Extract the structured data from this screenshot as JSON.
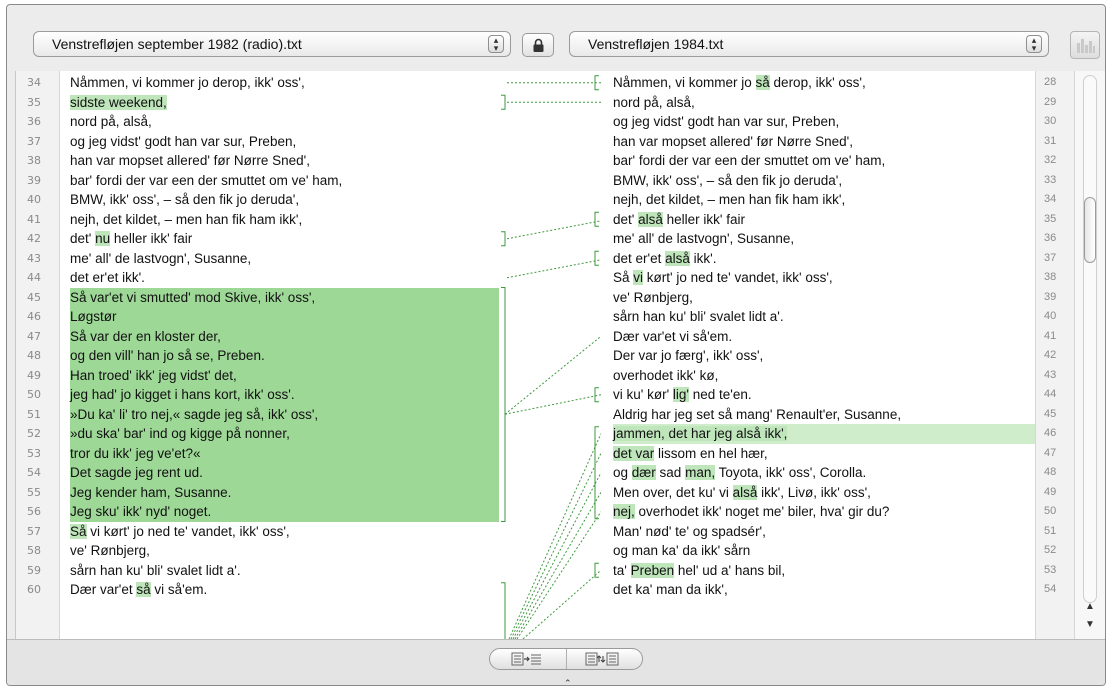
{
  "toolbar": {
    "left_file": "Venstrefløjen september 1982 (radio).txt",
    "right_file": "Venstrefløjen 1984.txt",
    "stepper_glyph": "▴▾"
  },
  "icons": [
    "lock-icon",
    "compare-view-icon",
    "merge-left-icon",
    "sync-icon",
    "scroll-up-icon",
    "scroll-down-icon"
  ],
  "left_lines": [
    {
      "n": "34",
      "segs": [
        {
          "t": "Nåmmen, vi kommer jo derop, ikk' oss',"
        }
      ]
    },
    {
      "n": "35",
      "segs": [
        {
          "t": "sidste weekend,",
          "h": true
        }
      ]
    },
    {
      "n": "36",
      "segs": [
        {
          "t": "nord på, alså,"
        }
      ]
    },
    {
      "n": "37",
      "segs": [
        {
          "t": "og jeg vidst' godt han var sur, Preben,"
        }
      ]
    },
    {
      "n": "38",
      "segs": [
        {
          "t": "han var mopset allered' før Nørre Sned',"
        }
      ]
    },
    {
      "n": "39",
      "segs": [
        {
          "t": "bar' fordi der var een der smuttet om ve' ham,"
        }
      ]
    },
    {
      "n": "40",
      "segs": [
        {
          "t": "BMW, ikk' oss', – så den fik jo deruda',"
        }
      ]
    },
    {
      "n": "41",
      "segs": [
        {
          "t": "nejh, det kildet, – men han fik ham ikk',"
        }
      ]
    },
    {
      "n": "42",
      "segs": [
        {
          "t": "det' "
        },
        {
          "t": "nu",
          "h": true
        },
        {
          "t": " heller ikk' fair"
        }
      ]
    },
    {
      "n": "43",
      "segs": [
        {
          "t": "me' all' de lastvogn', Susanne,"
        }
      ]
    },
    {
      "n": "44",
      "segs": [
        {
          "t": "det er'et ikk'."
        }
      ]
    },
    {
      "n": "45",
      "segs": [
        {
          "t": "Så var'et vi smutted' mod Skive, ikk' oss',"
        }
      ]
    },
    {
      "n": "46",
      "segs": [
        {
          "t": "Løgstør"
        }
      ]
    },
    {
      "n": "47",
      "segs": [
        {
          "t": "Så var der en kloster der,"
        }
      ]
    },
    {
      "n": "48",
      "segs": [
        {
          "t": "og den vill' han jo så se, Preben."
        }
      ]
    },
    {
      "n": "49",
      "segs": [
        {
          "t": "Han troed' ikk' jeg vidst' det,"
        }
      ]
    },
    {
      "n": "50",
      "segs": [
        {
          "t": "jeg had' jo kigget i hans kort, ikk' oss'."
        }
      ]
    },
    {
      "n": "51",
      "segs": [
        {
          "t": "»Du ka' li' tro nej,« sagde jeg så, ikk' oss',"
        }
      ]
    },
    {
      "n": "52",
      "segs": [
        {
          "t": "»du ska' bar' ind og kigge på nonner,"
        }
      ]
    },
    {
      "n": "53",
      "segs": [
        {
          "t": "tror du ikk' jeg ve'et?«"
        }
      ]
    },
    {
      "n": "54",
      "segs": [
        {
          "t": "Det sagde jeg rent ud."
        }
      ]
    },
    {
      "n": "55",
      "segs": [
        {
          "t": "Jeg kender ham, Susanne."
        }
      ]
    },
    {
      "n": "56",
      "segs": [
        {
          "t": "Jeg sku' ikk' nyd' noget."
        }
      ]
    },
    {
      "n": "57",
      "segs": [
        {
          "t": "Så",
          "h": true
        },
        {
          "t": " vi kørt' jo ned te' vandet, ikk' oss',"
        }
      ]
    },
    {
      "n": "58",
      "segs": [
        {
          "t": "ve' Rønbjerg,"
        }
      ]
    },
    {
      "n": "59",
      "segs": [
        {
          "t": "sårn han ku' bli' svalet lidt a'."
        }
      ]
    },
    {
      "n": "60",
      "segs": [
        {
          "t": "Dær var'et "
        },
        {
          "t": "så",
          "h": true
        },
        {
          "t": " vi så'em."
        }
      ]
    }
  ],
  "right_lines": [
    {
      "n": "28",
      "segs": [
        {
          "t": "Nåmmen, vi kommer jo "
        },
        {
          "t": "så",
          "h": true
        },
        {
          "t": " derop, ikk' oss',"
        }
      ]
    },
    {
      "n": "29",
      "segs": [
        {
          "t": "nord på, alså,"
        }
      ]
    },
    {
      "n": "30",
      "segs": [
        {
          "t": "og jeg vidst' godt han var sur, Preben,"
        }
      ]
    },
    {
      "n": "31",
      "segs": [
        {
          "t": "han var mopset allered' før Nørre Sned',"
        }
      ]
    },
    {
      "n": "32",
      "segs": [
        {
          "t": "bar' fordi der var een der smuttet om ve' ham,"
        }
      ]
    },
    {
      "n": "33",
      "segs": [
        {
          "t": "BMW, ikk' oss', – så den fik jo deruda',"
        }
      ]
    },
    {
      "n": "34",
      "segs": [
        {
          "t": "nejh, det kildet, – men han fik ham ikk',"
        }
      ]
    },
    {
      "n": "35",
      "segs": [
        {
          "t": "det' "
        },
        {
          "t": "alså",
          "h": true
        },
        {
          "t": " heller ikk' fair"
        }
      ]
    },
    {
      "n": "36",
      "segs": [
        {
          "t": "me' all' de lastvogn', Susanne,"
        }
      ]
    },
    {
      "n": "37",
      "segs": [
        {
          "t": "det er'et "
        },
        {
          "t": "alså",
          "h": true
        },
        {
          "t": " ikk'."
        }
      ]
    },
    {
      "n": "38",
      "segs": [
        {
          "t": "Så "
        },
        {
          "t": "vi",
          "h": true
        },
        {
          "t": " kørt' jo ned te' vandet, ikk' oss',"
        }
      ]
    },
    {
      "n": "39",
      "segs": [
        {
          "t": "ve' Rønbjerg,"
        }
      ]
    },
    {
      "n": "40",
      "segs": [
        {
          "t": "sårn han ku' bli' svalet lidt a'."
        }
      ]
    },
    {
      "n": "41",
      "segs": [
        {
          "t": "Dær var'et vi så'em."
        }
      ]
    },
    {
      "n": "42",
      "segs": [
        {
          "t": "Der var jo færg', ikk' oss',"
        }
      ]
    },
    {
      "n": "43",
      "segs": [
        {
          "t": "overhodet ikk' kø,"
        }
      ]
    },
    {
      "n": "44",
      "segs": [
        {
          "t": "vi ku' kør' "
        },
        {
          "t": "lig'",
          "h": true
        },
        {
          "t": " ned te'en."
        }
      ]
    },
    {
      "n": "45",
      "segs": [
        {
          "t": "Aldrig har jeg set så mang' Renault'er, Susanne,"
        }
      ]
    },
    {
      "n": "46",
      "segs": [
        {
          "t": "jammen, det har jeg alså ikk',",
          "h": true
        }
      ]
    },
    {
      "n": "47",
      "segs": [
        {
          "t": "det var",
          "h": true
        },
        {
          "t": " lissom en hel hær,"
        }
      ]
    },
    {
      "n": "48",
      "segs": [
        {
          "t": "og "
        },
        {
          "t": "dær",
          "h": true
        },
        {
          "t": " sad "
        },
        {
          "t": "man,",
          "h": true
        },
        {
          "t": " Toyota, ikk' oss', Corolla."
        }
      ]
    },
    {
      "n": "49",
      "segs": [
        {
          "t": "Men over, det ku' vi "
        },
        {
          "t": "alså",
          "h": true
        },
        {
          "t": " ikk', Livø, ikk' oss',"
        }
      ]
    },
    {
      "n": "50",
      "segs": [
        {
          "t": "nej,",
          "h": true
        },
        {
          "t": " overhodet ikk' noget me' biler, hva' gir du?"
        }
      ]
    },
    {
      "n": "51",
      "segs": [
        {
          "t": "Man' nød' te' og spadsér',"
        }
      ]
    },
    {
      "n": "52",
      "segs": [
        {
          "t": "og man ka' da ikk' sårn"
        }
      ]
    },
    {
      "n": "53",
      "segs": [
        {
          "t": "ta' "
        },
        {
          "t": "Preben",
          "h": true
        },
        {
          "t": " hel' ud a' hans bil,"
        }
      ]
    },
    {
      "n": "54",
      "segs": [
        {
          "t": "det ka' man da ikk',"
        }
      ]
    }
  ],
  "colors": {
    "accent": "#9ed897",
    "highlight": "#bfe5bb",
    "connector": "#3f9a3f"
  }
}
